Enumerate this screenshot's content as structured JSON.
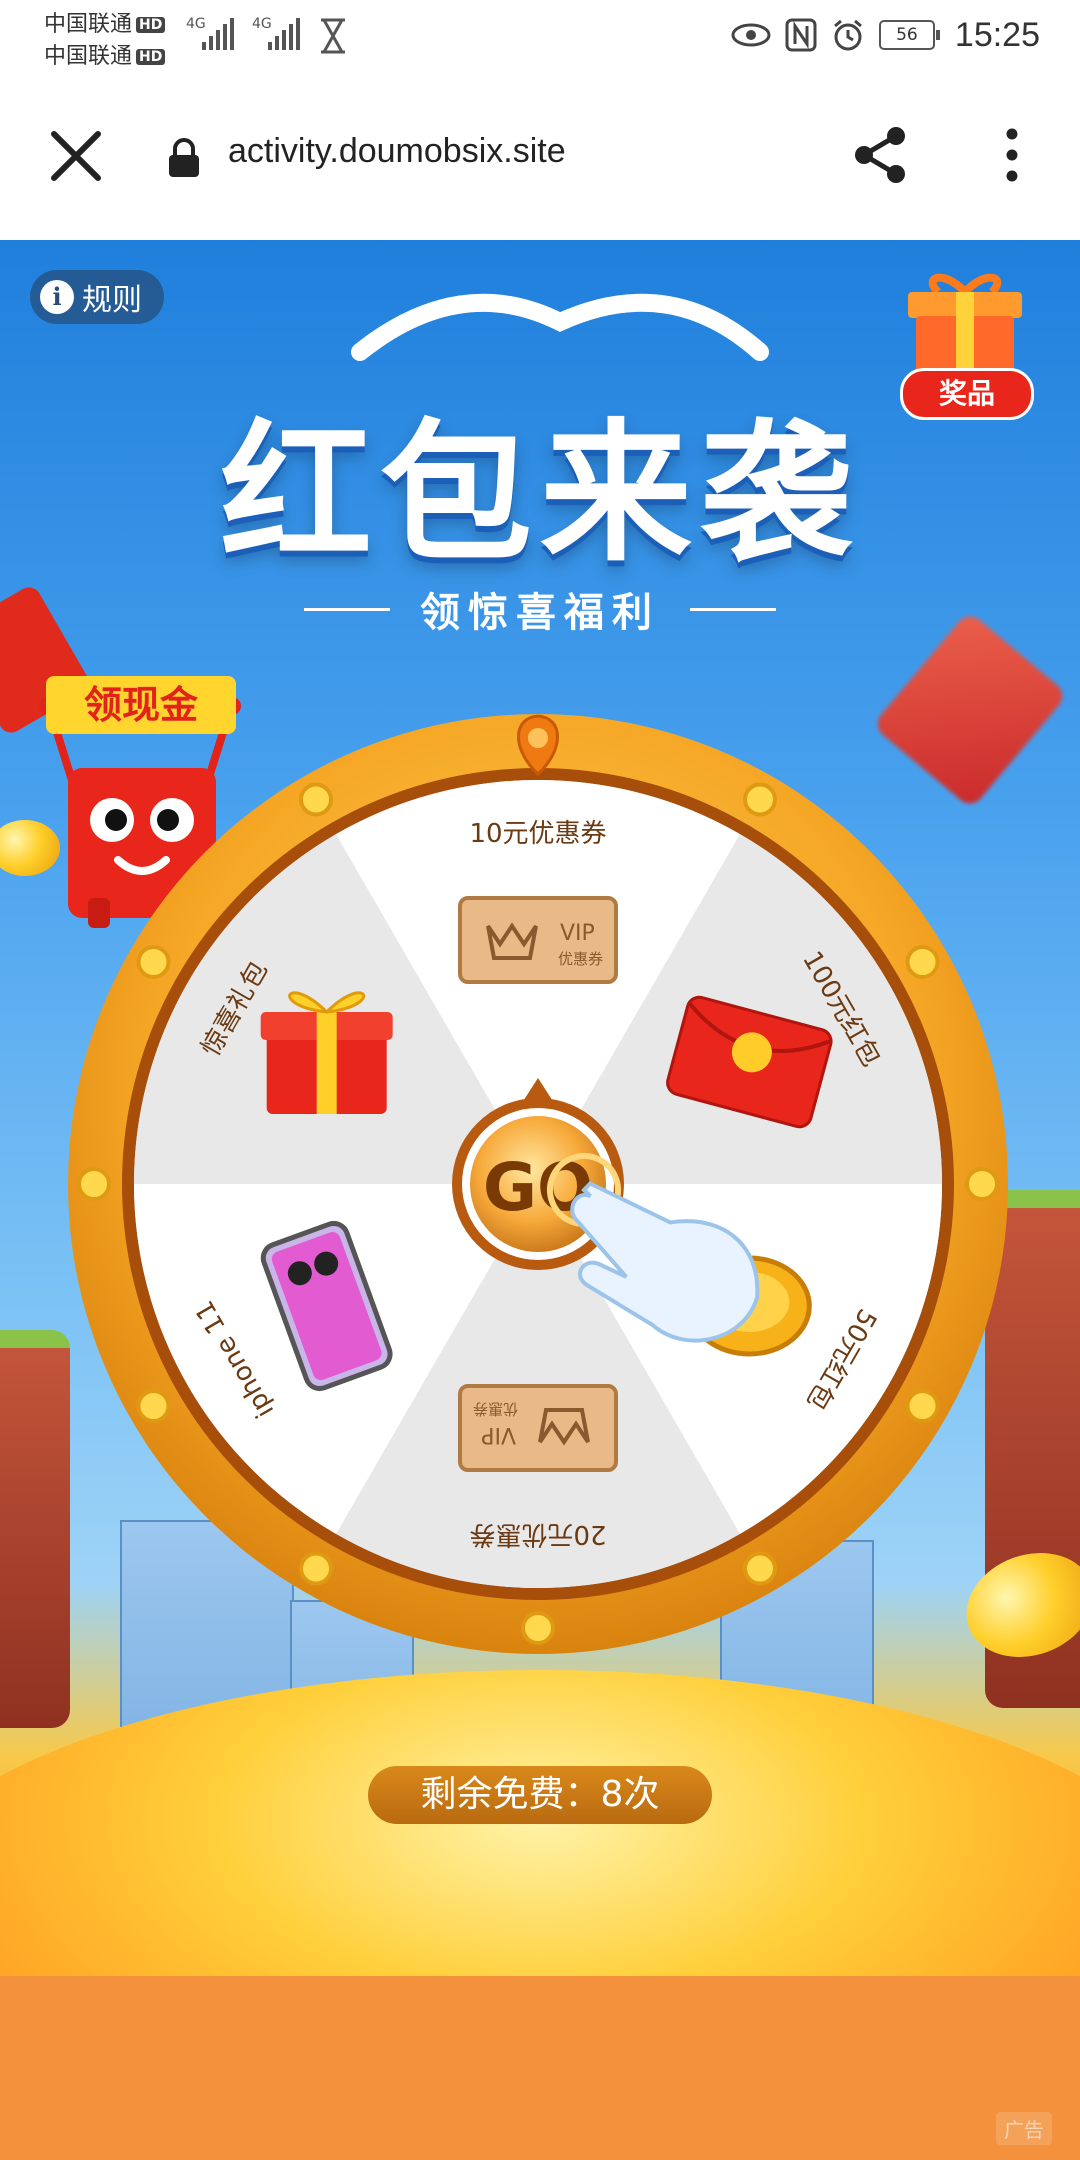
{
  "status_bar": {
    "carrier_1": "中国联通",
    "carrier_2": "中国联通",
    "hd_badge": "HD",
    "network_1": "4G",
    "network_2": "4G",
    "battery_level": "56",
    "time": "15:25"
  },
  "browser": {
    "url": "activity.doumobsix.site"
  },
  "page": {
    "rules_label": "规则",
    "rules_icon": "i",
    "prize_label": "奖品",
    "title": "红包来袭",
    "subtitle": "领惊喜福利",
    "cash_badge": "领现金",
    "wheel": {
      "center_label": "GO",
      "segments": [
        {
          "label": "10元优惠券",
          "icon": "vip-coupon-icon",
          "coupon_text": "VIP",
          "coupon_sub": "优惠券"
        },
        {
          "label": "100元红包",
          "icon": "red-envelope-icon"
        },
        {
          "label": "50元红包",
          "icon": "gold-coin-icon"
        },
        {
          "label": "20元优惠券",
          "icon": "vip-coupon-icon",
          "coupon_text": "VIP",
          "coupon_sub": "优惠券"
        },
        {
          "label": "iphone 11",
          "icon": "iphone-icon"
        },
        {
          "label": "惊喜礼包",
          "icon": "gift-box-icon"
        }
      ]
    },
    "remaining_free": "剩余免费：8次",
    "ad_tag": "广告"
  }
}
